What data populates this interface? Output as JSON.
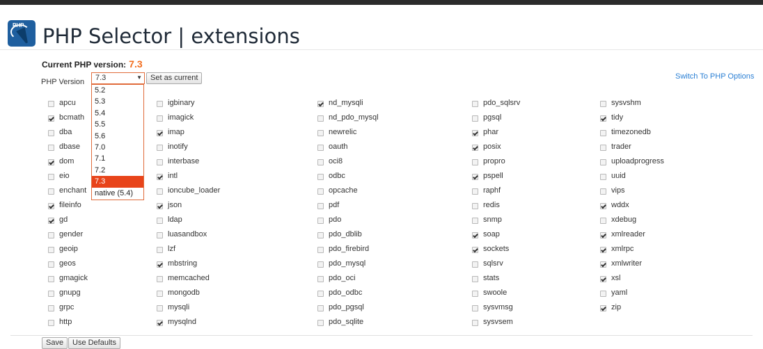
{
  "header": {
    "title": "PHP Selector | extensions",
    "logo_text": "PHP"
  },
  "current_version": {
    "label": "Current PHP version:",
    "value": "7.3"
  },
  "selector": {
    "label": "PHP Version",
    "selected": "7.3",
    "options": [
      "5.2",
      "5.3",
      "5.4",
      "5.5",
      "5.6",
      "7.0",
      "7.1",
      "7.2",
      "7.3",
      "native (5.4)"
    ],
    "set_button": "Set as current"
  },
  "switch_link": "Switch To PHP Options",
  "columns": [
    [
      {
        "name": "apcu",
        "checked": false
      },
      {
        "name": "bcmath",
        "checked": true
      },
      {
        "name": "dba",
        "checked": false
      },
      {
        "name": "dbase",
        "checked": false
      },
      {
        "name": "dom",
        "checked": true
      },
      {
        "name": "eio",
        "checked": false
      },
      {
        "name": "enchant",
        "checked": false
      },
      {
        "name": "fileinfo",
        "checked": true
      },
      {
        "name": "gd",
        "checked": true
      },
      {
        "name": "gender",
        "checked": false
      },
      {
        "name": "geoip",
        "checked": false
      },
      {
        "name": "geos",
        "checked": false
      },
      {
        "name": "gmagick",
        "checked": false
      },
      {
        "name": "gnupg",
        "checked": false
      },
      {
        "name": "grpc",
        "checked": false
      },
      {
        "name": "http",
        "checked": false
      }
    ],
    [
      {
        "name": "igbinary",
        "checked": false
      },
      {
        "name": "imagick",
        "checked": false
      },
      {
        "name": "imap",
        "checked": true
      },
      {
        "name": "inotify",
        "checked": false
      },
      {
        "name": "interbase",
        "checked": false
      },
      {
        "name": "intl",
        "checked": true
      },
      {
        "name": "ioncube_loader",
        "checked": false
      },
      {
        "name": "json",
        "checked": true
      },
      {
        "name": "ldap",
        "checked": false
      },
      {
        "name": "luasandbox",
        "checked": false
      },
      {
        "name": "lzf",
        "checked": false
      },
      {
        "name": "mbstring",
        "checked": true
      },
      {
        "name": "memcached",
        "checked": false
      },
      {
        "name": "mongodb",
        "checked": false
      },
      {
        "name": "mysqli",
        "checked": false
      },
      {
        "name": "mysqlnd",
        "checked": true
      }
    ],
    [
      {
        "name": "nd_mysqli",
        "checked": true
      },
      {
        "name": "nd_pdo_mysql",
        "checked": false
      },
      {
        "name": "newrelic",
        "checked": false
      },
      {
        "name": "oauth",
        "checked": false
      },
      {
        "name": "oci8",
        "checked": false
      },
      {
        "name": "odbc",
        "checked": false
      },
      {
        "name": "opcache",
        "checked": false
      },
      {
        "name": "pdf",
        "checked": false
      },
      {
        "name": "pdo",
        "checked": false
      },
      {
        "name": "pdo_dblib",
        "checked": false
      },
      {
        "name": "pdo_firebird",
        "checked": false
      },
      {
        "name": "pdo_mysql",
        "checked": false
      },
      {
        "name": "pdo_oci",
        "checked": false
      },
      {
        "name": "pdo_odbc",
        "checked": false
      },
      {
        "name": "pdo_pgsql",
        "checked": false
      },
      {
        "name": "pdo_sqlite",
        "checked": false
      }
    ],
    [
      {
        "name": "pdo_sqlsrv",
        "checked": false
      },
      {
        "name": "pgsql",
        "checked": false
      },
      {
        "name": "phar",
        "checked": true
      },
      {
        "name": "posix",
        "checked": true
      },
      {
        "name": "propro",
        "checked": false
      },
      {
        "name": "pspell",
        "checked": true
      },
      {
        "name": "raphf",
        "checked": false
      },
      {
        "name": "redis",
        "checked": false
      },
      {
        "name": "snmp",
        "checked": false
      },
      {
        "name": "soap",
        "checked": true
      },
      {
        "name": "sockets",
        "checked": true
      },
      {
        "name": "sqlsrv",
        "checked": false
      },
      {
        "name": "stats",
        "checked": false
      },
      {
        "name": "swoole",
        "checked": false
      },
      {
        "name": "sysvmsg",
        "checked": false
      },
      {
        "name": "sysvsem",
        "checked": false
      }
    ],
    [
      {
        "name": "sysvshm",
        "checked": false
      },
      {
        "name": "tidy",
        "checked": true
      },
      {
        "name": "timezonedb",
        "checked": false
      },
      {
        "name": "trader",
        "checked": false
      },
      {
        "name": "uploadprogress",
        "checked": false
      },
      {
        "name": "uuid",
        "checked": false
      },
      {
        "name": "vips",
        "checked": false
      },
      {
        "name": "wddx",
        "checked": true
      },
      {
        "name": "xdebug",
        "checked": false
      },
      {
        "name": "xmlreader",
        "checked": true
      },
      {
        "name": "xmlrpc",
        "checked": true
      },
      {
        "name": "xmlwriter",
        "checked": true
      },
      {
        "name": "xsl",
        "checked": true
      },
      {
        "name": "yaml",
        "checked": false
      },
      {
        "name": "zip",
        "checked": true
      }
    ]
  ],
  "footer": {
    "save": "Save",
    "defaults": "Use Defaults"
  },
  "colors": {
    "accent": "#f26c1c",
    "selected_option": "#e8441a",
    "link": "#2a7fd4"
  },
  "icons": {
    "logo": "php-selector-logo-icon",
    "dropdown": "caret-down-icon"
  }
}
